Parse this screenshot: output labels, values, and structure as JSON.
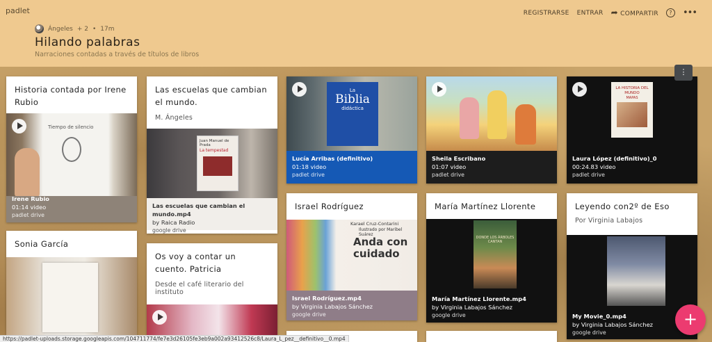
{
  "header": {
    "logo": "padlet",
    "actions": {
      "register": "REGISTRARSE",
      "login": "ENTRAR",
      "share": "COMPARTIR"
    },
    "author": "Ángeles",
    "contributors": "+ 2",
    "time": "17m",
    "title": "Hilando palabras",
    "subtitle": "Narraciones contadas a través de títulos de libros"
  },
  "cards": {
    "c1": {
      "title": "Historia contada por Irene Rubio",
      "att": {
        "title": "Irene Rubio",
        "sub": "01:14 video",
        "src": "padlet drive"
      }
    },
    "c2": {
      "title": "Sonia García"
    },
    "c3": {
      "title": "Las escuelas que cambian el mundo.",
      "body": "M. Ángeles",
      "att": {
        "title": "Las escuelas que cambian el mundo.mp4",
        "sub": "by Raica Radio",
        "src": "google drive"
      }
    },
    "c4": {
      "title": "Os voy a contar un cuento. Patricia",
      "body": "Desde el café literario del instituto"
    },
    "c5": {
      "att": {
        "title": "Lucía Arribas (definitivo)",
        "sub": "01:18 video",
        "src": "padlet drive"
      }
    },
    "c6": {
      "title": "Israel Rodríguez",
      "att": {
        "title": "Israel Rodríguez.mp4",
        "sub": "by Virginia Labajos Sánchez",
        "src": "google drive"
      }
    },
    "c7": {
      "att": {
        "title": "Sheila Escribano",
        "sub": "01:07 video",
        "src": "padlet drive"
      }
    },
    "c8": {
      "title": "María Martínez Llorente",
      "att": {
        "title": "María Martínez Llorente.mp4",
        "sub": "by Virginia Labajos Sánchez",
        "src": "google drive"
      }
    },
    "c9": {
      "att": {
        "title": "Laura López (definitivo)_0",
        "sub": "00:24.83 video",
        "src": "padlet drive"
      }
    },
    "c10": {
      "title": "Leyendo con2º de Eso",
      "body": "Por Virginia Labajos",
      "att": {
        "title": "My Movie_0.mp4",
        "sub": "by Virginia Labajos Sánchez",
        "src": "google drive"
      }
    }
  },
  "thumb_text": {
    "c1": "Tiempo de silencio",
    "c3a": "Juan Manuel de Prada",
    "c3b": "La tempestad",
    "c5a": "La",
    "c5b": "Biblia",
    "c5c": "didáctica",
    "c6a": "Karael Cruz-Contarini",
    "c6b": "Ilustrado por Maribel Suárez",
    "c6c": "Anda con cuidado",
    "c8": "DONDE LOS ÁRBOLES CANTAN",
    "c9a": "LA HISTORIA DEL MUNDO",
    "c9b": "MAPAS"
  },
  "fab_label": "+",
  "status_url": "https://padlet-uploads.storage.googleapis.com/104711774/fe7e3d26105fe3eb9a002a93412526c8/Laura_L_pez__definitivo__0.mp4",
  "colors": {
    "header_bg": "#efc98f",
    "fab": "#ec3b70",
    "blue_att": "#1559b5"
  }
}
